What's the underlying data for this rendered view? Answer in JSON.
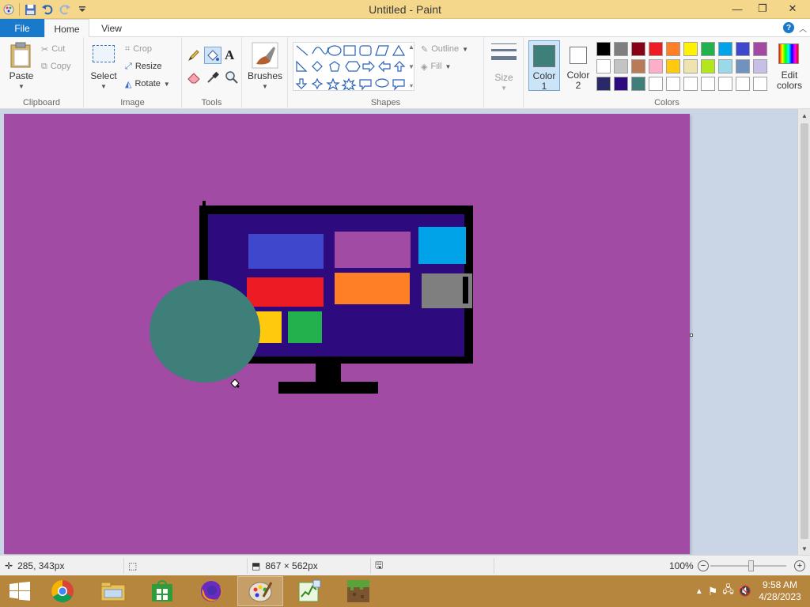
{
  "window": {
    "title": "Untitled - Paint",
    "minimize": "—",
    "restore": "❐",
    "close": "✕"
  },
  "tabs": {
    "file": "File",
    "home": "Home",
    "view": "View",
    "help": "?"
  },
  "ribbon": {
    "clipboard": {
      "label": "Clipboard",
      "paste": "Paste",
      "cut": "Cut",
      "copy": "Copy"
    },
    "image": {
      "label": "Image",
      "select": "Select",
      "crop": "Crop",
      "resize": "Resize",
      "rotate": "Rotate"
    },
    "tools": {
      "label": "Tools",
      "text_glyph": "A"
    },
    "brushes": {
      "label": "Brushes"
    },
    "shapes": {
      "label": "Shapes",
      "outline": "Outline",
      "fill": "Fill"
    },
    "size": {
      "label": "Size"
    },
    "colors": {
      "label": "Colors",
      "color1_line1": "Color",
      "color1_line2": "1",
      "color2_line1": "Color",
      "color2_line2": "2",
      "edit_line1": "Edit",
      "edit_line2": "colors",
      "color1_value": "#3f7f7a",
      "color2_value": "#ffffff",
      "palette": [
        "#000000",
        "#7f7f7f",
        "#880015",
        "#ed1c24",
        "#ff7f27",
        "#fff200",
        "#22b14c",
        "#00a2e8",
        "#3f48cc",
        "#a349a4",
        "#ffffff",
        "#c3c3c3",
        "#b97a57",
        "#ffaec9",
        "#ffc90e",
        "#efe4b0",
        "#b5e61d",
        "#99d9ea",
        "#7092be",
        "#c8bfe7",
        "#2a2866",
        "#2d0a7e",
        "#3f7f7a",
        "#ffffff",
        "#ffffff",
        "#ffffff",
        "#ffffff",
        "#ffffff",
        "#ffffff",
        "#ffffff"
      ]
    }
  },
  "canvas": {
    "background": "#a14ba4",
    "drawing_colors": {
      "monitor_frame": "#000000",
      "screen": "#2d0a7e",
      "tile_blue": "#3f48cc",
      "tile_purple": "#a14ba4",
      "tile_cyan": "#00a2e8",
      "tile_red": "#ed1c24",
      "tile_orange": "#ff7f27",
      "tile_gray": "#7f7f7f",
      "tile_yellow": "#ffc90e",
      "tile_green": "#22b14c",
      "ellipse": "#3f7f7a"
    }
  },
  "statusbar": {
    "cursor_pos": "285, 343px",
    "canvas_size": "867 × 562px",
    "zoom": "100%"
  },
  "taskbar": {
    "time": "9:58 AM",
    "date": "4/28/2023",
    "apps": [
      "chrome-icon",
      "file-explorer-icon",
      "store-icon",
      "firefox-icon",
      "paint-icon",
      "task-manager-icon",
      "minecraft-icon"
    ]
  }
}
